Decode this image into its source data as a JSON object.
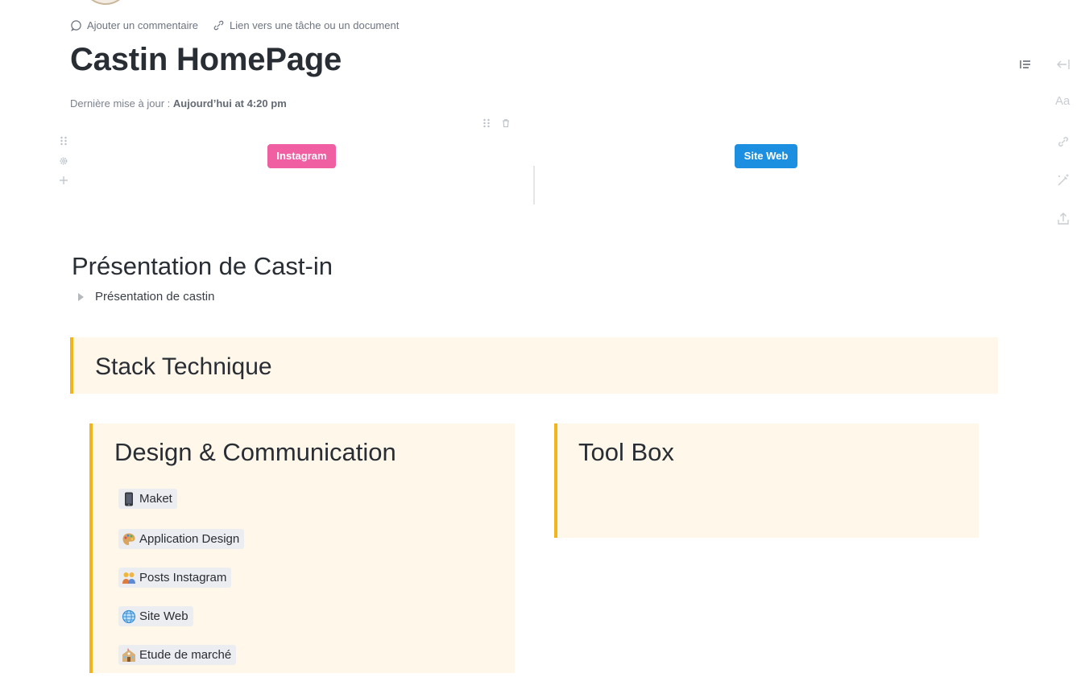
{
  "topbar": {
    "comment": "Ajouter un commentaire",
    "link": "Lien vers une tâche ou un document"
  },
  "page": {
    "title": "Castin HomePage",
    "updated_label": "Dernière mise à jour :",
    "updated_value": "Aujourd’hui at 4:20 pm"
  },
  "buttons": {
    "instagram": "Instagram",
    "site_web": "Site Web"
  },
  "presentation": {
    "heading": "Présentation de Cast-in",
    "toggle_label": "Présentation de castin"
  },
  "stack": {
    "heading": "Stack Technique"
  },
  "design": {
    "heading": "Design & Communication",
    "links": [
      {
        "icon": "mobile-phone-icon",
        "label": "Maket"
      },
      {
        "icon": "palette-icon",
        "label": "Application Design"
      },
      {
        "icon": "people-icon",
        "label": "Posts Instagram"
      },
      {
        "icon": "globe-icon",
        "label": "Site Web"
      },
      {
        "icon": "school-building-icon",
        "label": "Etude de marché"
      }
    ]
  },
  "toolbox": {
    "heading": "Tool Box"
  },
  "right_rail": {
    "text_icon_label": "Aa"
  },
  "colors": {
    "instagram": "#ef5fa1",
    "site_web": "#1d8fe1",
    "callout_bg": "#fff8ea",
    "callout_accent": "#f2b31b"
  }
}
